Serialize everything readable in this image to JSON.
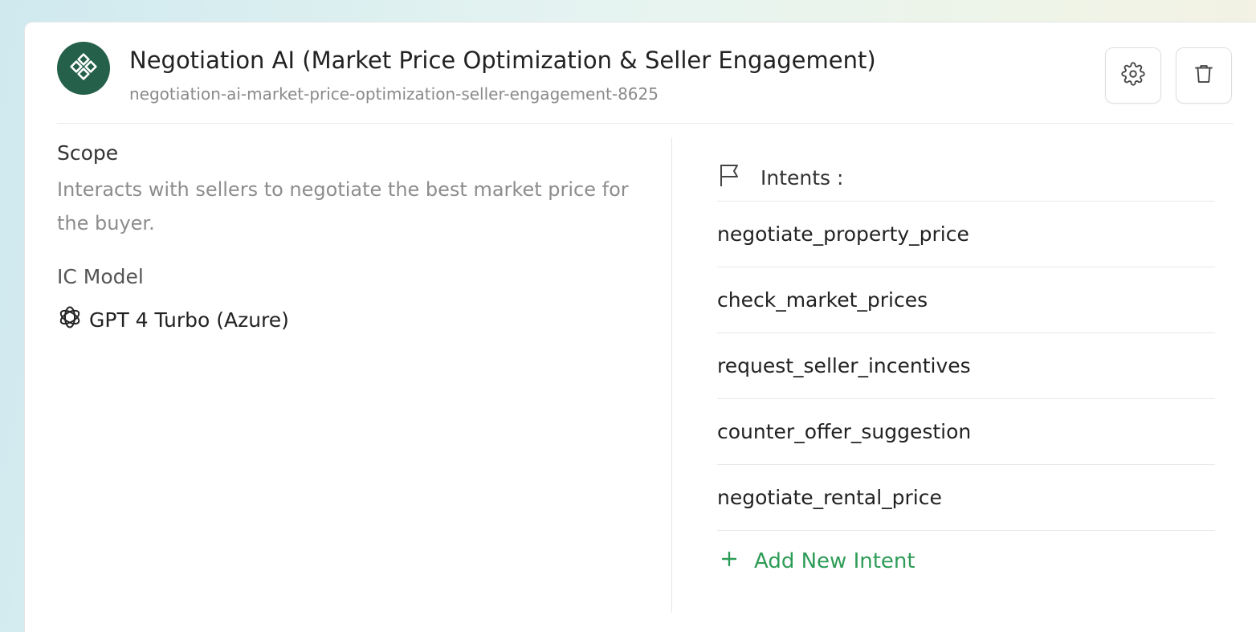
{
  "agent": {
    "title": "Negotiation AI (Market Price Optimization & Seller Engagement)",
    "slug": "negotiation-ai-market-price-optimization-seller-engagement-8625",
    "icon": "diamond-grid-icon",
    "accent_color": "#24604a"
  },
  "actions": {
    "settings_icon": "gear-icon",
    "delete_icon": "trash-icon"
  },
  "scope": {
    "label": "Scope",
    "text": "Interacts with sellers to negotiate the best market price for the buyer."
  },
  "ic_model": {
    "label": "IC Model",
    "value": "GPT 4 Turbo (Azure)",
    "icon": "openai-icon"
  },
  "intents": {
    "label": "Intents :",
    "icon": "flag-icon",
    "items": [
      {
        "name": "negotiate_property_price"
      },
      {
        "name": "check_market_prices"
      },
      {
        "name": "request_seller_incentives"
      },
      {
        "name": "counter_offer_suggestion"
      },
      {
        "name": "negotiate_rental_price"
      }
    ],
    "add_label": "Add New Intent",
    "add_color": "#2e9c57"
  }
}
